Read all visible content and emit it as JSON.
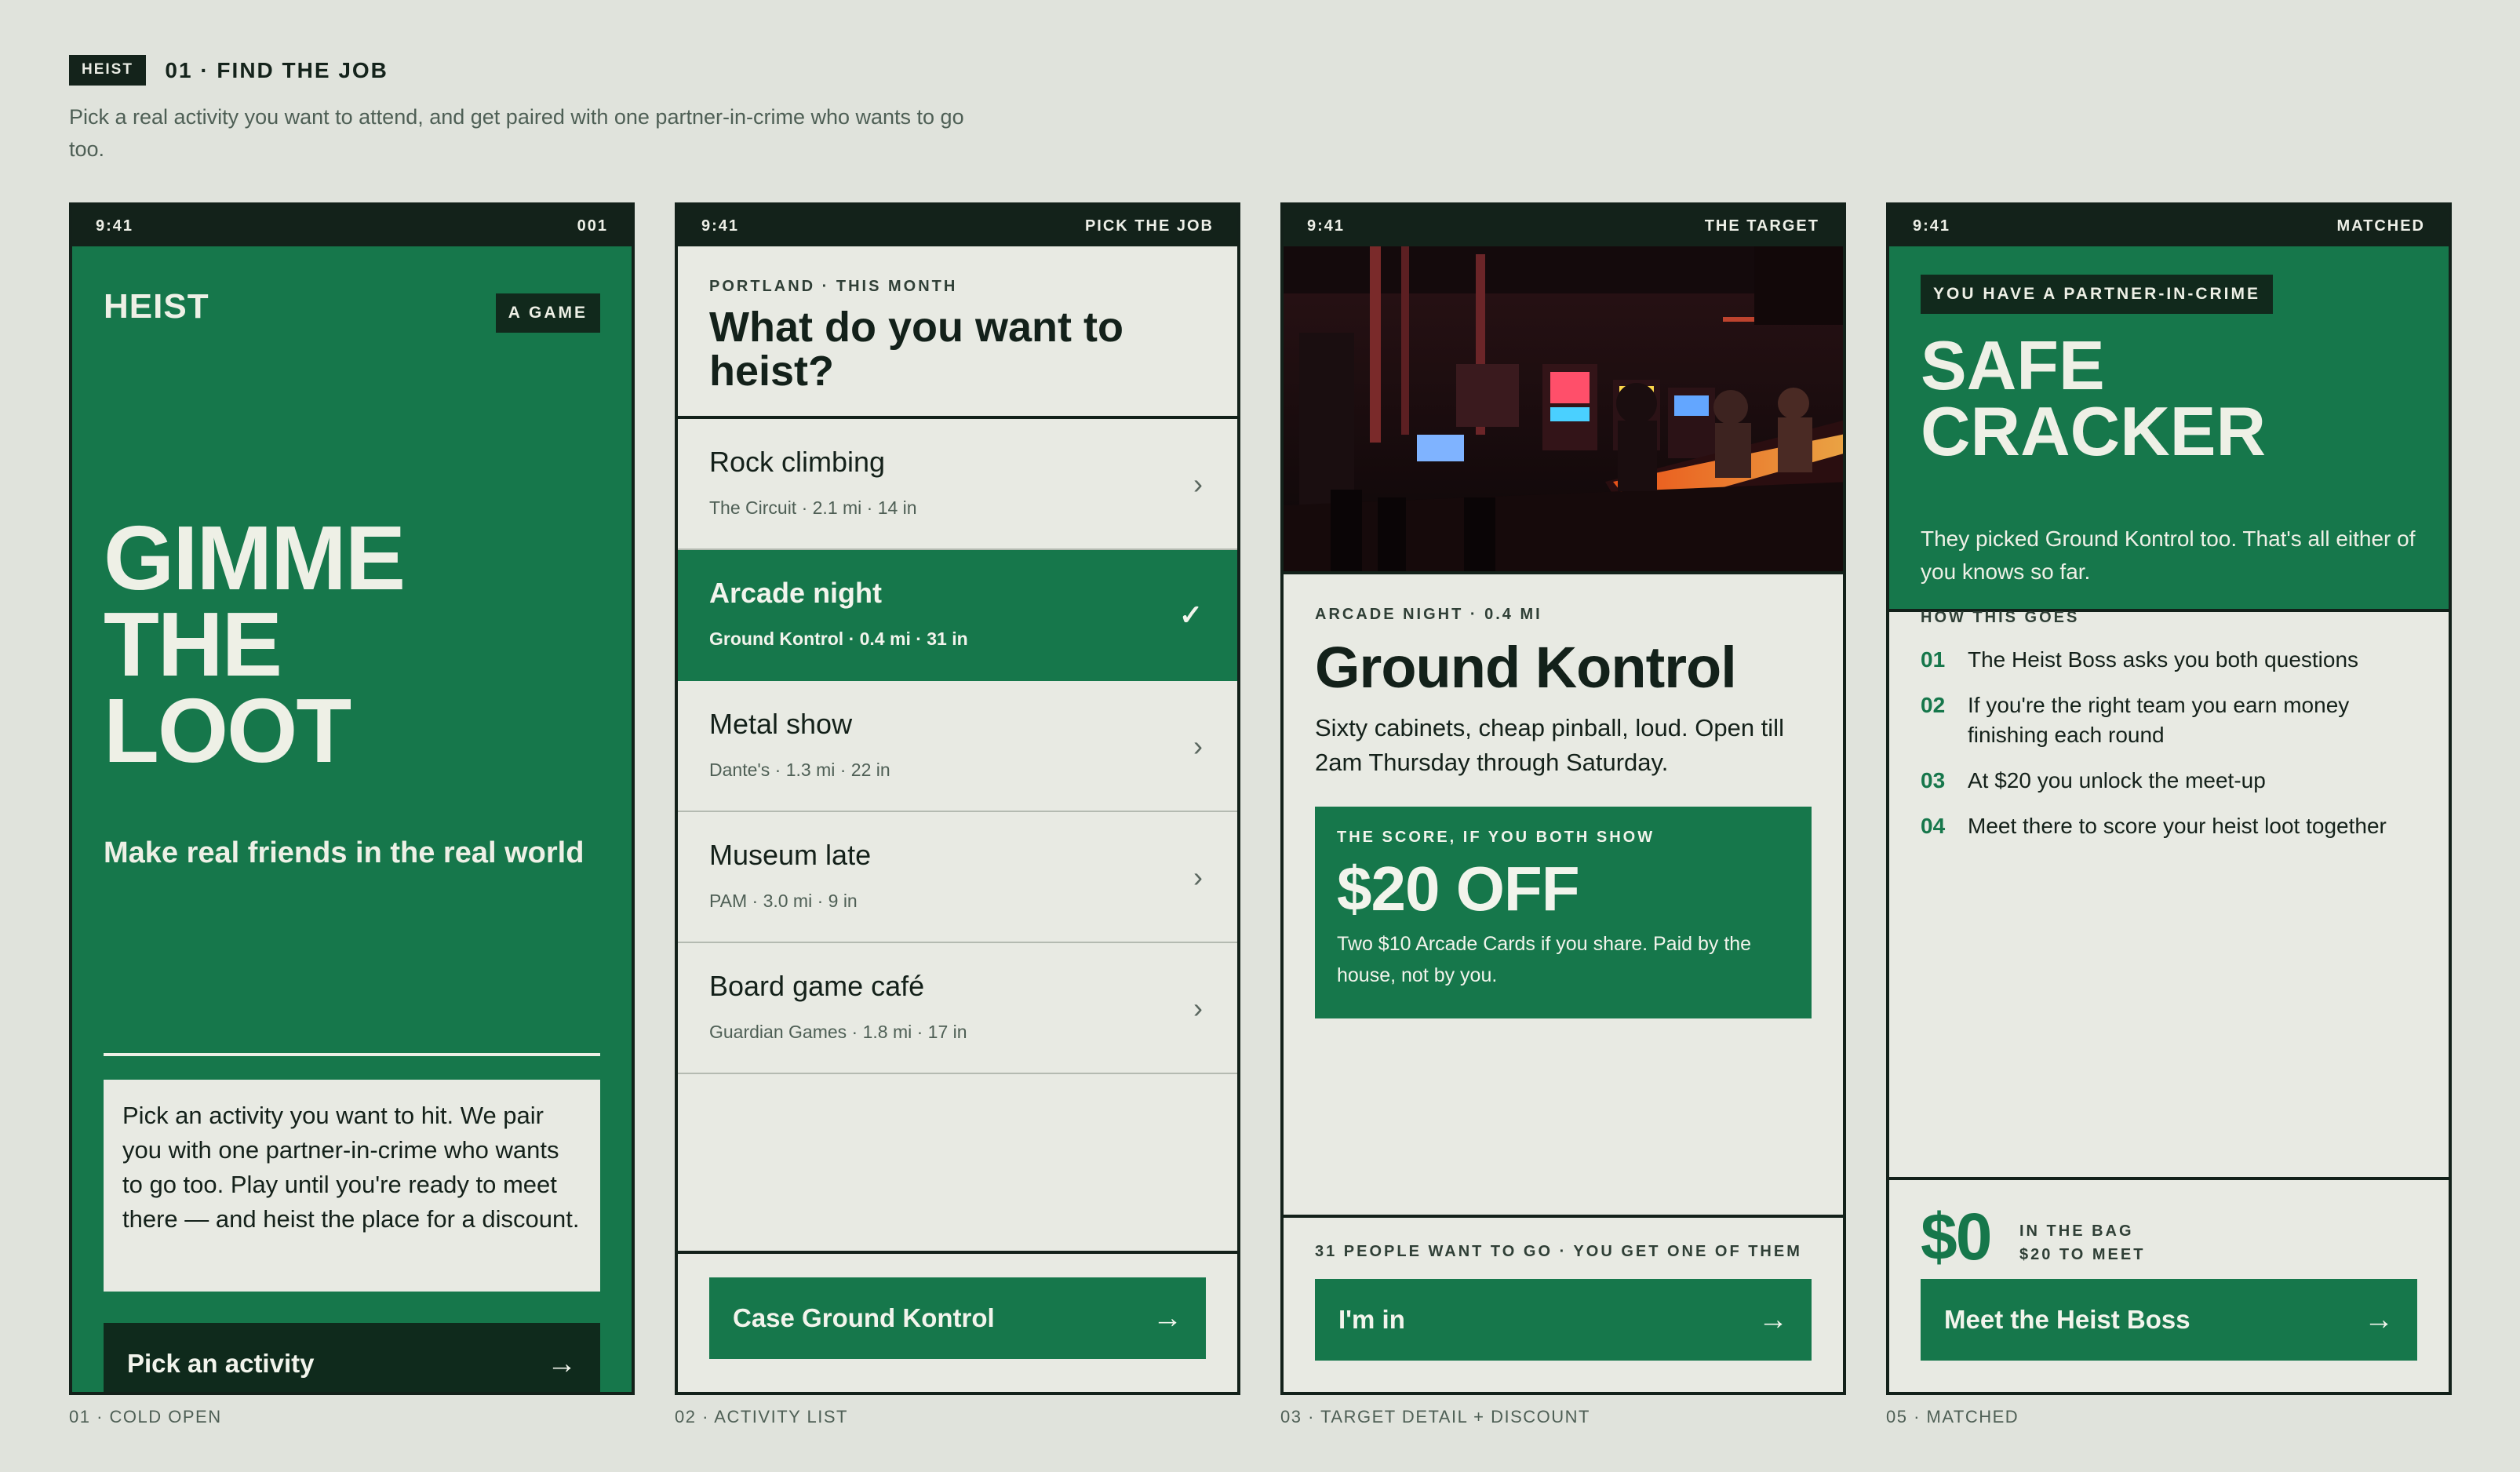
{
  "header": {
    "tag": "HEIST",
    "title": "01 · FIND THE JOB",
    "description": "Pick a real activity you want to attend, and get paired with one partner-in-crime who wants to go too."
  },
  "screens": [
    {
      "status_time": "9:41",
      "status_right": "001",
      "brand": "HEIST",
      "badge": "A GAME",
      "hero": [
        "GIMME",
        "THE",
        "LOOT"
      ],
      "subtitle": "Make real friends in the real world",
      "card_text": "Pick an activity you want to hit. We pair you with one partner-in-crime who wants to go too. Play until you're ready to meet there — and heist the place for a discount.",
      "cta": "Pick an activity",
      "cta_icon": "arrow-right-icon",
      "caption": "01 · COLD OPEN"
    },
    {
      "status_time": "9:41",
      "status_right": "PICK THE JOB",
      "kicker": "PORTLAND · THIS MONTH",
      "question": "What do you want to heist?",
      "activities": [
        {
          "title": "Rock climbing",
          "meta": "The Circuit · 2.1 mi · 14 in",
          "selected": false
        },
        {
          "title": "Arcade night",
          "meta": "Ground Kontrol · 0.4 mi · 31 in",
          "selected": true
        },
        {
          "title": "Metal show",
          "meta": "Dante's · 1.3 mi · 22 in",
          "selected": false
        },
        {
          "title": "Museum late",
          "meta": "PAM · 3.0 mi · 9 in",
          "selected": false
        },
        {
          "title": "Board game café",
          "meta": "Guardian Games · 1.8 mi · 17 in",
          "selected": false
        }
      ],
      "chevron": "›",
      "check": "✓",
      "cta": "Case Ground Kontrol",
      "caption": "02 · ACTIVITY LIST"
    },
    {
      "status_time": "9:41",
      "status_right": "THE TARGET",
      "kicker": "ARCADE NIGHT · 0.4 MI",
      "name": "Ground Kontrol",
      "description": "Sixty cabinets, cheap pinball, loud. Open till 2am Thursday through Saturday.",
      "score_kicker": "THE SCORE, IF YOU BOTH SHOW",
      "score_value": "$20 OFF",
      "score_text": "Two $10 Arcade Cards if you share. Paid by the house, not by you.",
      "footer_kicker": "31 PEOPLE WANT TO GO · YOU GET ONE OF THEM",
      "cta": "I'm in",
      "caption": "03 · TARGET DETAIL + DISCOUNT"
    },
    {
      "status_time": "9:41",
      "status_right": "MATCHED",
      "badge": "YOU HAVE A PARTNER-IN-CRIME",
      "hero": [
        "SAFE",
        "CRACKER"
      ],
      "description": "They picked Ground Kontrol too. That's all either of you knows so far.",
      "how_title": "HOW THIS GOES",
      "steps": [
        {
          "n": "01",
          "text": "The Heist Boss asks you both questions"
        },
        {
          "n": "02",
          "text": "If you're the right team you earn money finishing each round"
        },
        {
          "n": "03",
          "text": "At $20 you unlock the meet-up"
        },
        {
          "n": "04",
          "text": "Meet there to score your heist loot together"
        }
      ],
      "amount": "$0",
      "bag_label": "IN THE BAG",
      "bag_sub": "$20 TO MEET",
      "cta": "Meet the Heist Boss",
      "caption": "05 · MATCHED"
    }
  ],
  "icons": {
    "arrow": "→"
  },
  "colors": {
    "green": "#16774b",
    "dark": "#13211a",
    "paper": "#e8eae3",
    "background": "#e0e3dc"
  }
}
